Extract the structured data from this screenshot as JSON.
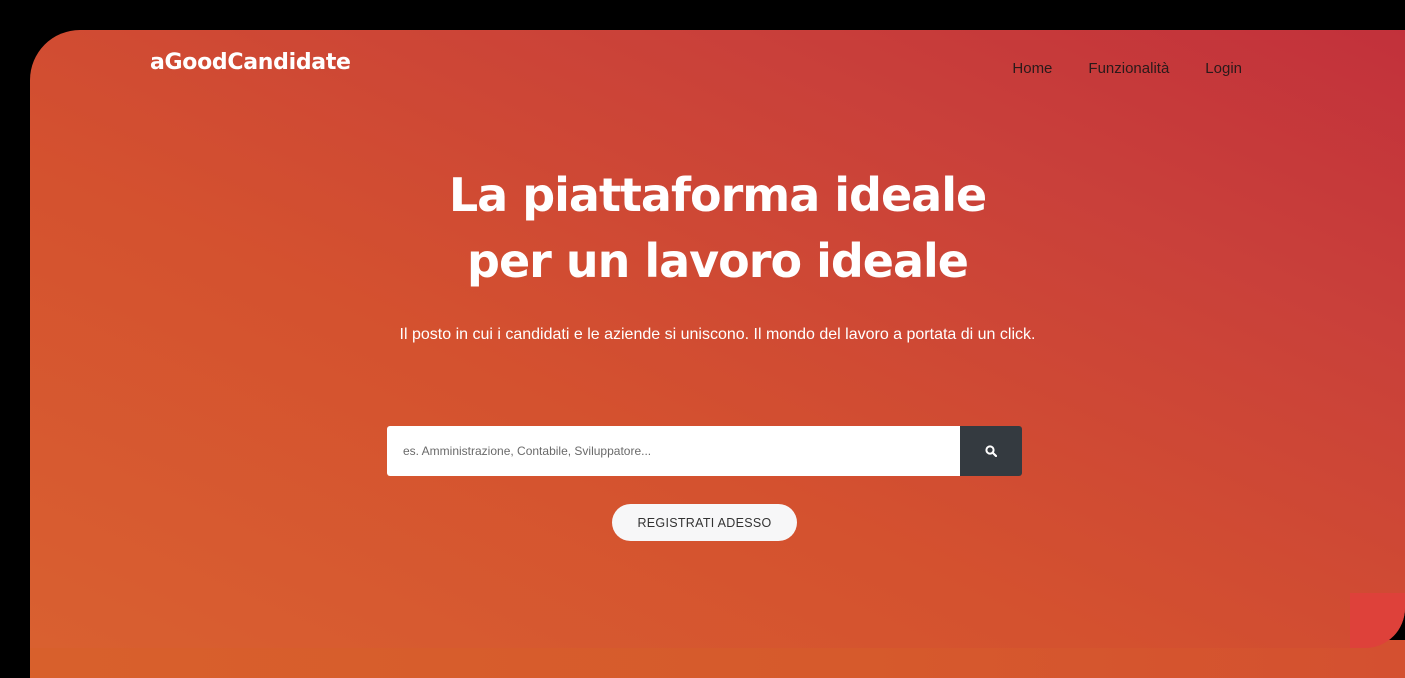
{
  "brand": {
    "name": "aGoodCandidate"
  },
  "nav": {
    "items": [
      "Home",
      "Funzionalità",
      "Login"
    ]
  },
  "hero": {
    "headline_line1": "La piattaforma ideale",
    "headline_line2": "per un lavoro ideale",
    "subtitle": "Il posto in cui i candidati e le aziende si uniscono. Il mondo del lavoro a portata di un click.",
    "search": {
      "placeholder": "es. Amministrazione, Contabile, Sviluppatore...",
      "value": "",
      "button_icon": "search-icon"
    },
    "cta_label": "REGISTRATI ADESSO"
  },
  "colors": {
    "gradient_start": "#d96030",
    "gradient_end": "#c2313b",
    "search_button": "#343a40",
    "cta_background": "#f7f7f8",
    "text_light": "#ffffff",
    "nav_text": "#2a1a1a"
  }
}
